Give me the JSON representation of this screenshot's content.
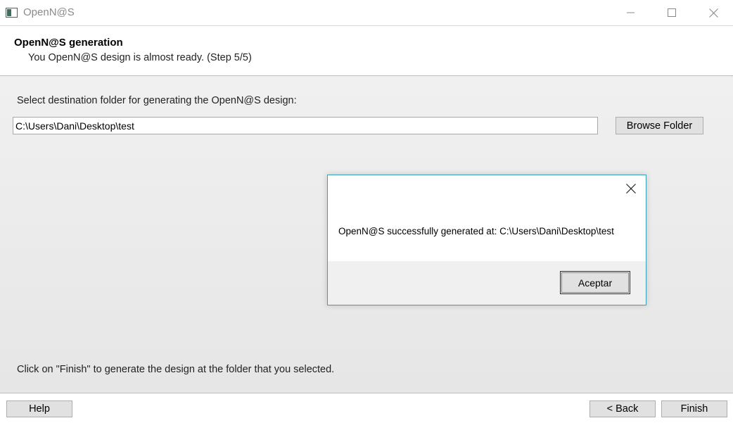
{
  "window": {
    "title": "OpenN@S",
    "icon": "app-window-icon"
  },
  "header": {
    "title": "OpenN@S generation",
    "subtitle": "You OpenN@S design is almost ready. (Step 5/5)"
  },
  "main": {
    "destination_label": "Select destination folder for generating the OpenN@S design:",
    "destination_path": "C:\\Users\\Dani\\Desktop\\test",
    "browse_label": "Browse Folder",
    "finish_hint": "Click on \"Finish\" to generate the design at the folder that you selected."
  },
  "footer": {
    "help_label": "Help",
    "back_label": "< Back",
    "finish_label": "Finish"
  },
  "dialog": {
    "message": "OpenN@S successfully generated at: C:\\Users\\Dani\\Desktop\\test",
    "ok_label": "Aceptar",
    "border_color": "#3aa0b8"
  }
}
